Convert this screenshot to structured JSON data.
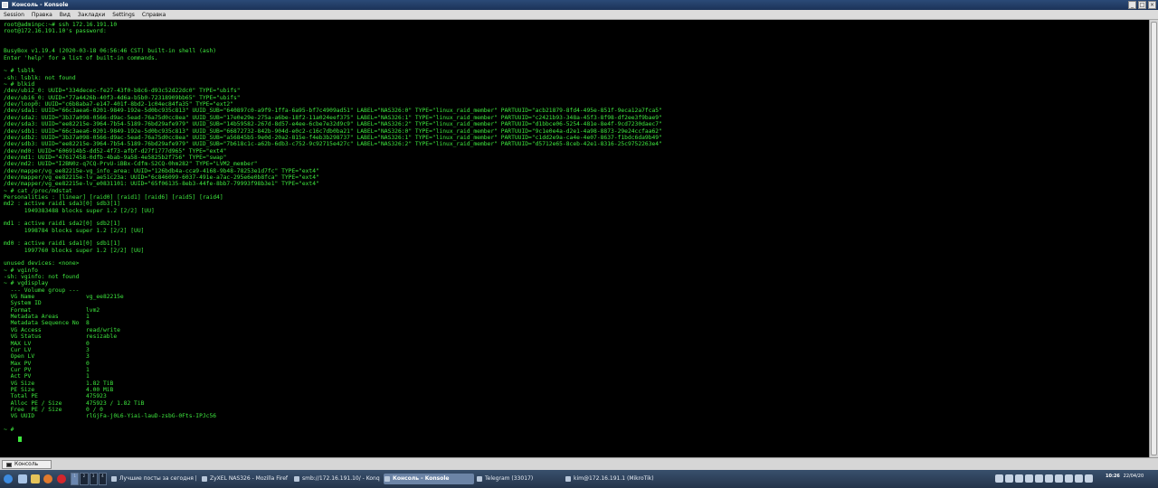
{
  "window": {
    "title": "Консоль - Konsole",
    "buttons": [
      "_",
      "□",
      "×"
    ]
  },
  "menu": [
    "Session",
    "Правка",
    "Вид",
    "Закладки",
    "Settings",
    "Справка"
  ],
  "terminal": {
    "lines": [
      "root@adminpc:~# ssh 172.16.191.10",
      "root@172.16.191.10's password:",
      "",
      "",
      "BusyBox v1.19.4 (2020-03-18 06:56:46 CST) built-in shell (ash)",
      "Enter 'help' for a list of built-in commands.",
      "",
      "~ # lsblk",
      "-sh: lsblk: not found",
      "~ # blkid",
      "/dev/ubi2_0: UUID=\"334decec-fe27-43f0-b8c6-d93c52d22dc0\" TYPE=\"ubifs\"",
      "/dev/ubi6_0: UUID=\"77a4426b-40f3-4d6a-b5b0-72318909bb65\" TYPE=\"ubifs\"",
      "/dev/loop0: UUID=\"c6b8aba7-e147-401f-8bd2-1c04ec84fa35\" TYPE=\"ext2\"",
      "/dev/sda1: UUID=\"66c3aea6-0201-9849-192e-5d0bc935c813\" UUID_SUB=\"640897c0-a9f9-1ffa-6a95-bf7c4909ad51\" LABEL=\"NAS326:0\" TYPE=\"linux_raid_member\" PARTUUID=\"acb21879-8fd4-495e-851f-9eca12a7fca5\"",
      "/dev/sda2: UUID=\"3b37a098-0566-d9ac-5ead-76a75d0cc8ea\" UUID_SUB=\"17e0e29e-275a-a6be-18f2-11a024eef375\" LABEL=\"NAS326:1\" TYPE=\"linux_raid_member\" PARTUUID=\"c2421b93-348a-45f3-8f98-df2ee3f9bae9\"",
      "/dev/sda3: UUID=\"ee82215e-3964-7b54-5189-76bd29afe979\" UUID_SUB=\"14b59582-267d-8d57-e4ee-6cbe7e32d9c9\" LABEL=\"NAS326:2\" TYPE=\"linux_raid_member\" PARTUUID=\"d1bbce06-5254-481e-8e4f-9cd7230daec7\"",
      "/dev/sdb1: UUID=\"66c3aea6-0201-9849-192e-5d0bc935c813\" UUID_SUB=\"66872732-842b-904d-e0c2-c16c7db0ba21\" LABEL=\"NAS326:0\" TYPE=\"linux_raid_member\" PARTUUID=\"9c1e0e4a-d2e1-4a98-8873-29e24ccfaa62\"",
      "/dev/sdb2: UUID=\"3b37a098-0566-d9ac-5ead-76a75d0cc8ea\" UUID_SUB=\"a56845b5-9e0d-20a2-815e-f4eb3b298737\" LABEL=\"NAS326:1\" TYPE=\"linux_raid_member\" PARTUUID=\"c1dd2e9a-ca4e-4e07-8637-f1bdc6da9b49\"",
      "/dev/sdb3: UUID=\"ee82215e-3964-7b54-5189-76bd29afe979\" UUID_SUB=\"7b618c1c-a62b-6db3-c752-9c92715e427c\" LABEL=\"NAS326:2\" TYPE=\"linux_raid_member\" PARTUUID=\"d5712e65-8ceb-42e1-8316-25c9752263e4\"",
      "/dev/md0: UUID=\"606914b5-dd52-4f73-afbf-d27f1777d965\" TYPE=\"ext4\"",
      "/dev/md1: UUID=\"47617458-0dfb-4bab-9a58-4e5825b2f756\" TYPE=\"swap\"",
      "/dev/md2: UUID=\"I2BN0z-q7CQ-PrvU-iBBx-Cdfm-S2CQ-0hm282\" TYPE=\"LVM2_member\"",
      "/dev/mapper/vg_ee82215e-vg_info_area: UUID=\"126bdb4a-cca9-4168-9b48-78253e1d7fc\" TYPE=\"ext4\"",
      "/dev/mapper/vg_ee82215e-lv_ae51c23a: UUID=\"6c846099-6037-491e-a7ac-295e6e0b8fca\" TYPE=\"ext4\"",
      "/dev/mapper/vg_ee82215e-lv_e0831101: UUID=\"65f06135-8eb3-44fe-8bb7-79993f98b3e1\" TYPE=\"ext4\"",
      "~ # cat /proc/mdstat",
      "Personalities : [linear] [raid0] [raid1] [raid6] [raid5] [raid4]",
      "md2 : active raid1 sda3[0] sdb3[1]",
      "      1949383488 blocks super 1.2 [2/2] [UU]",
      "",
      "md1 : active raid1 sda2[0] sdb2[1]",
      "      1998784 blocks super 1.2 [2/2] [UU]",
      "",
      "md0 : active raid1 sda1[0] sdb1[1]",
      "      1997760 blocks super 1.2 [2/2] [UU]",
      "",
      "unused devices: <none>",
      "~ # vginfo",
      "-sh: vginfo: not found",
      "~ # vgdisplay",
      "  --- Volume group ---",
      "  VG Name               vg_ee82215e",
      "  System ID",
      "  Format                lvm2",
      "  Metadata Areas        1",
      "  Metadata Sequence No  8",
      "  VG Access             read/write",
      "  VG Status             resizable",
      "  MAX LV                0",
      "  Cur LV                3",
      "  Open LV               3",
      "  Max PV                0",
      "  Cur PV                1",
      "  Act PV                1",
      "  VG Size               1.82 TiB",
      "  PE Size               4.00 MiB",
      "  Total PE              475923",
      "  Alloc PE / Size       475923 / 1.82 TiB",
      "  Free  PE / Size       0 / 0",
      "  VG UUID               rlGjFa-j0L6-Yiai-lauD-zsbG-0Fts-IPJc56",
      "",
      "~ # "
    ]
  },
  "tab": {
    "label": "Консоль"
  },
  "taskbar": {
    "pager": [
      "1",
      "2",
      "3",
      "4"
    ],
    "tasks": [
      {
        "label": "Лучшие посты за сегодня |"
      },
      {
        "label": "ZyXEL NAS326 - Mozilla Firef"
      },
      {
        "label": "smb://172.16.191.10/ - Konq"
      },
      {
        "label": "Консоль - Konsole",
        "active": true
      },
      {
        "label": "Telegram (33017)"
      },
      {
        "label": "kim@172.16.191.1 (MikroTik)"
      }
    ],
    "clock": {
      "time": "10:26",
      "date": "22/04/20"
    }
  }
}
